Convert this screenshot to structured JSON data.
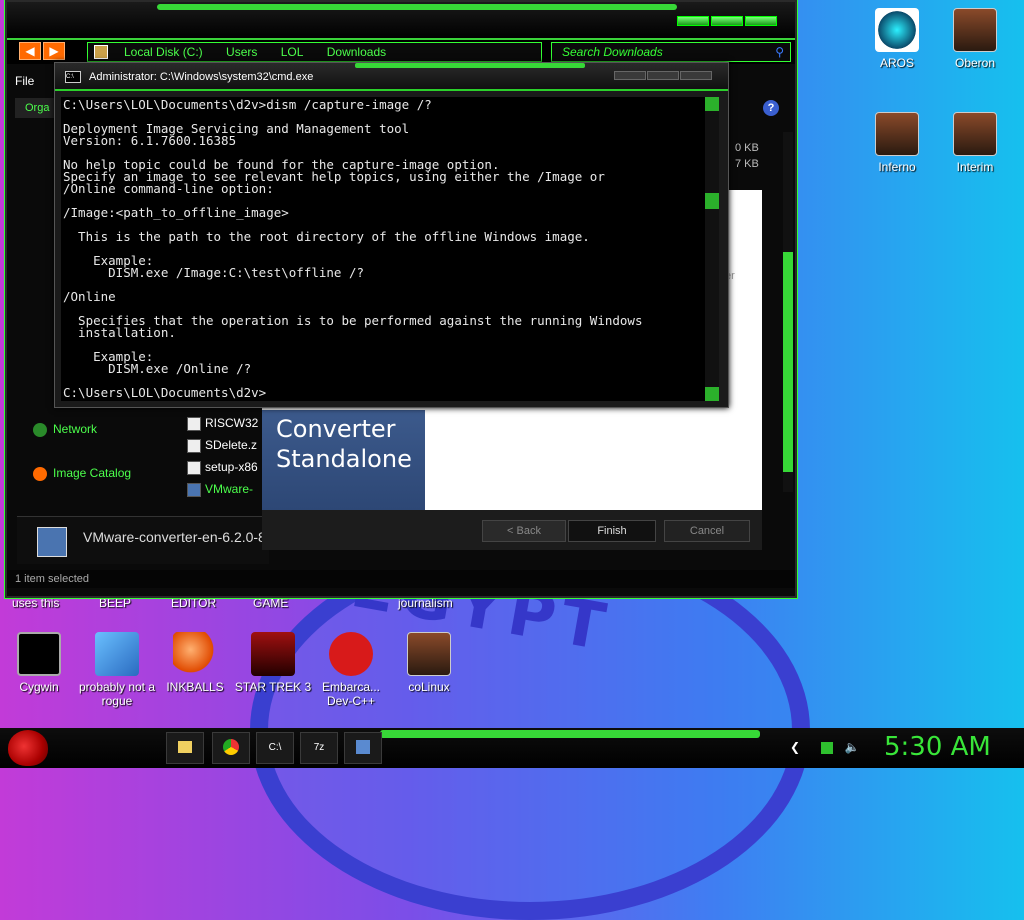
{
  "desktop": {
    "wallpaper_text": "EGYPT",
    "icons_right": [
      {
        "label": "AROS"
      },
      {
        "label": "Oberon"
      },
      {
        "label": "Inferno"
      },
      {
        "label": "Interim"
      }
    ],
    "top_labels": [
      "uses this",
      "BEEP",
      "EDITOR",
      "GAME",
      "journalism"
    ],
    "icons_bottom": [
      {
        "label": "Cygwin"
      },
      {
        "label": "probably not a rogue"
      },
      {
        "label": "INKBALLS"
      },
      {
        "label": "STAR TREK 3"
      },
      {
        "label": "Embarca... Dev-C++"
      },
      {
        "label": "coLinux"
      }
    ]
  },
  "explorer": {
    "breadcrumb": [
      "Local Disk (C:)",
      "Users",
      "LOL",
      "Downloads"
    ],
    "search_placeholder": "Search Downloads",
    "menu_file": "File",
    "organize": "Orga",
    "nav_items": [
      {
        "label": "Network"
      },
      {
        "label": "Image Catalog"
      }
    ],
    "files": [
      {
        "name": "RISCW32"
      },
      {
        "name": "SDelete.z"
      },
      {
        "name": "setup-x86"
      },
      {
        "name": "VMware-"
      }
    ],
    "right_sizes": [
      "0 KB",
      "7 KB"
    ],
    "right_text": [
      "ter",
      "t"
    ],
    "details_name": "VMware-converter-en-6.2.0-8",
    "status": "1 item selected"
  },
  "converter": {
    "side_title_1": "Converter",
    "side_title_2": "Standalone",
    "back": "< Back",
    "finish": "Finish",
    "cancel": "Cancel"
  },
  "cmd": {
    "title": "Administrator: C:\\Windows\\system32\\cmd.exe",
    "icon_text": "C:\\",
    "output": "C:\\Users\\LOL\\Documents\\d2v>dism /capture-image /?\n\nDeployment Image Servicing and Management tool\nVersion: 6.1.7600.16385\n\nNo help topic could be found for the capture-image option.\nSpecify an image to see relevant help topics, using either the /Image or\n/Online command-line option:\n\n/Image:<path_to_offline_image>\n\n  This is the path to the root directory of the offline Windows image.\n\n    Example:\n      DISM.exe /Image:C:\\test\\offline /?\n\n/Online\n\n  Specifies that the operation is to be performed against the running Windows\n  installation.\n\n    Example:\n      DISM.exe /Online /?\n\nC:\\Users\\LOL\\Documents\\d2v>"
  },
  "taskbar": {
    "buttons": [
      "",
      "",
      "C:\\",
      "7z",
      ""
    ],
    "clock": "5:30 AM"
  }
}
